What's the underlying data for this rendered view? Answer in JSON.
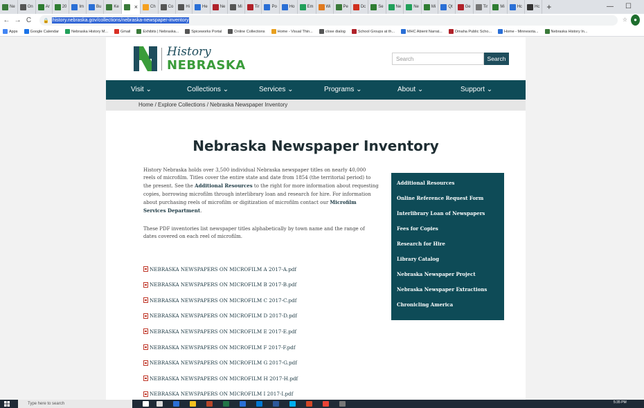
{
  "browser": {
    "tabs": [
      {
        "label": "Ne",
        "color": "#3a7a3a"
      },
      {
        "label": "On",
        "color": "#555555"
      },
      {
        "label": "Ar",
        "color": "#2f7d32"
      },
      {
        "label": "20",
        "color": "#2f7d32"
      },
      {
        "label": "Im",
        "color": "#2a6fd6"
      },
      {
        "label": "Bu",
        "color": "#2a6fd6"
      },
      {
        "label": "Ke",
        "color": "#3a7a3a"
      },
      {
        "label": "",
        "color": "#3a7a3a",
        "active": true
      },
      {
        "label": "Ch",
        "color": "#f4a020"
      },
      {
        "label": "Co",
        "color": "#555555"
      },
      {
        "label": "Hi",
        "color": "#555555"
      },
      {
        "label": "He",
        "color": "#2a6fd6"
      },
      {
        "label": "Ne",
        "color": "#b0222a"
      },
      {
        "label": "Mi",
        "color": "#555555"
      },
      {
        "label": "Tir",
        "color": "#b0222a"
      },
      {
        "label": "Po",
        "color": "#2a6fd6"
      },
      {
        "label": "Ho",
        "color": "#2a6fd6"
      },
      {
        "label": "Em",
        "color": "#21a05a"
      },
      {
        "label": "Wi",
        "color": "#e07a20"
      },
      {
        "label": "Pe",
        "color": "#3a7a3a"
      },
      {
        "label": "Dc",
        "color": "#d03020"
      },
      {
        "label": "Se",
        "color": "#2f7d32"
      },
      {
        "label": "Ne",
        "color": "#21a05a"
      },
      {
        "label": "Ne",
        "color": "#21a05a"
      },
      {
        "label": "Mi",
        "color": "#2f7d32"
      },
      {
        "label": "Qt",
        "color": "#2a6fd6"
      },
      {
        "label": "Ge",
        "color": "#b0222a"
      },
      {
        "label": "Tir",
        "color": "#777777"
      },
      {
        "label": "Mi",
        "color": "#2f7d32"
      },
      {
        "label": "Hc",
        "color": "#2a6fd6"
      },
      {
        "label": "Hc",
        "color": "#333333"
      }
    ],
    "new_tab": "+",
    "minimize": "—",
    "maximize": "☐",
    "nav_back": "←",
    "nav_forward": "→",
    "nav_reload": "C",
    "url": "history.nebraska.gov/collections/nebraska-newspaper-inventory",
    "bookmarks": [
      {
        "label": "Apps",
        "color": "#4285f4"
      },
      {
        "label": "Google Calendar",
        "color": "#1a73e8"
      },
      {
        "label": "Nebraska History M...",
        "color": "#21a05a"
      },
      {
        "label": "Gmail",
        "color": "#d93025"
      },
      {
        "label": "Exhibits | Nebraska...",
        "color": "#3a7a3a"
      },
      {
        "label": "Spiceworks Portal",
        "color": "#555555"
      },
      {
        "label": "Online Collections",
        "color": "#555555"
      },
      {
        "label": "Home - Visual Thin...",
        "color": "#e8a020"
      },
      {
        "label": "close dialog",
        "color": "#555555"
      },
      {
        "label": "School Groups at th...",
        "color": "#b0222a"
      },
      {
        "label": "MHC Abient Narrat...",
        "color": "#2a6fd6"
      },
      {
        "label": "Omaha Public Scho...",
        "color": "#b0222a"
      },
      {
        "label": "Home - Minnesota...",
        "color": "#2a6fd6"
      },
      {
        "label": "Nebraska History In...",
        "color": "#3a7a3a"
      }
    ]
  },
  "header": {
    "logo_history": "History",
    "logo_nebraska": "NEBRASKA",
    "search_placeholder": "Search",
    "search_button": "Search"
  },
  "nav": {
    "items": [
      "Visit ⌄",
      "Collections ⌄",
      "Services ⌄",
      "Programs ⌄",
      "About ⌄",
      "Support ⌄"
    ]
  },
  "breadcrumb": "Home / Explore Collections / Nebraska Newspaper Inventory",
  "main": {
    "title": "Nebraska Newspaper Inventory",
    "intro_1": "History Nebraska holds over 3,500 individual Nebraska newspaper titles on nearly 40,000 reels of microfilm. Titles cover the entire state and date from 1854 (the territorial period) to the present. See the ",
    "intro_link_1": "Additional Resources",
    "intro_2": " to the right for more information about requesting copies, borrowing microfilm through interlibrary loan and research for hire. For information about purchasing reels of microfilm or digitization of microfilm contact our ",
    "intro_link_2": "Microfilm Services Department",
    "intro_3": ".",
    "pdf_note": "These PDF inventories list newspaper titles alphabetically by town name and the range of dates covered on each reel of microfilm.",
    "pdfs": [
      "NEBRASKA NEWSPAPERS ON MICROFILM A 2017-A.pdf",
      "NEBRASKA NEWSPAPERS ON MICROFILM B 2017-B.pdf",
      "NEBRASKA NEWSPAPERS ON MICROFILM C 2017-C.pdf",
      "NEBRASKA NEWSPAPERS ON MICROFILM D 2017-D.pdf",
      "NEBRASKA NEWSPAPERS ON MICROFILM E 2017-E.pdf",
      "NEBRASKA NEWSPAPERS ON MICROFILM F 2017-F.pdf",
      "NEBRASKA NEWSPAPERS ON MICROFILM G 2017-G.pdf",
      "NEBRASKA NEWSPAPERS ON MICROFILM H 2017-H.pdf",
      "NEBRASKA NEWSPAPERS ON MICROFILM I 2017-I.pdf"
    ]
  },
  "sidebar": {
    "links": [
      "Additional Resources",
      "Online Reference Request Form",
      "Interlibrary Loan of Newspapers",
      "Fees for Copies",
      "Research for Hire",
      "Library Catalog",
      "Nebraska Newspaper Project",
      "Nebraska Newspaper Extractions",
      "Chronicling America"
    ]
  },
  "taskbar": {
    "search_placeholder": "Type here to search",
    "time": "5:35 PM"
  },
  "colors": {
    "brand_teal": "#0e4b57",
    "brand_green": "#3a9c3a"
  }
}
